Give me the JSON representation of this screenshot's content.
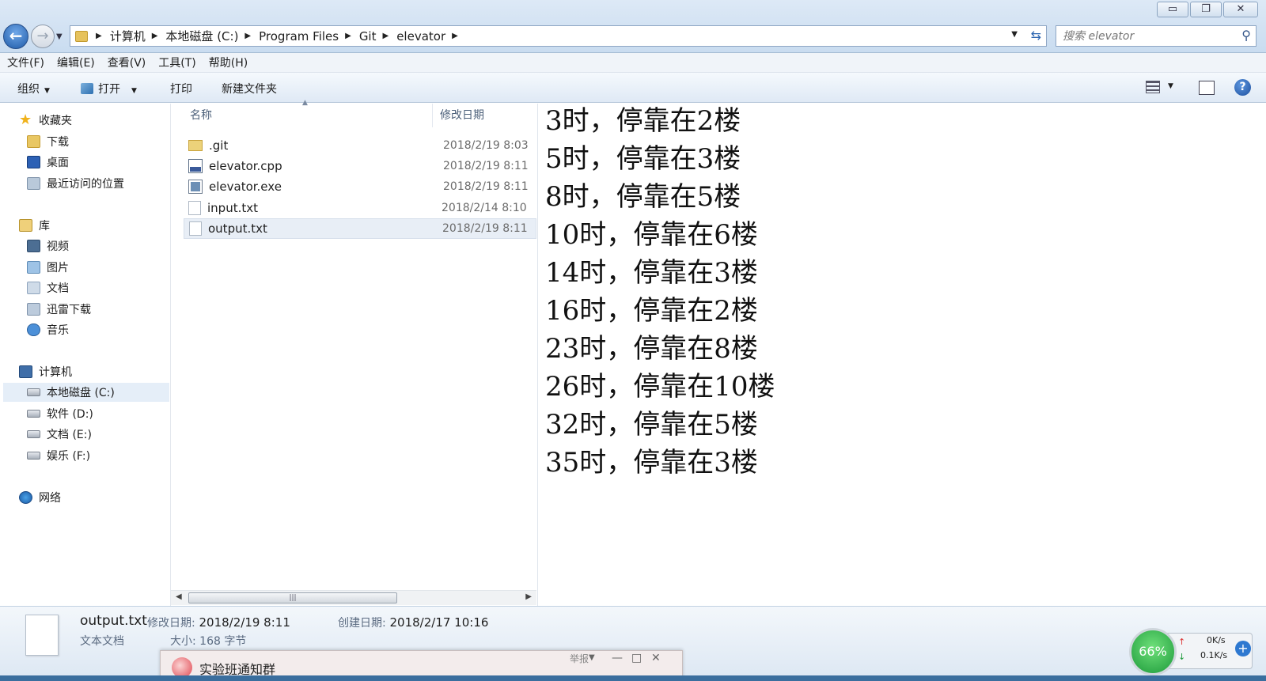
{
  "window": {
    "minimize": "▭",
    "restore": "❐",
    "close": "✕"
  },
  "address_bar": {
    "crumbs": [
      "计算机",
      "本地磁盘 (C:)",
      "Program Files",
      "Git",
      "elevator"
    ]
  },
  "search": {
    "placeholder": "搜索 elevator"
  },
  "menu": [
    "文件(F)",
    "编辑(E)",
    "查看(V)",
    "工具(T)",
    "帮助(H)"
  ],
  "toolbar": {
    "organize": "组织",
    "open": "打开",
    "print": "打印",
    "new_folder": "新建文件夹"
  },
  "nav": {
    "favorites": "收藏夹",
    "downloads": "下载",
    "desktop": "桌面",
    "recent": "最近访问的位置",
    "libraries": "库",
    "videos": "视频",
    "pictures": "图片",
    "documents": "文档",
    "xunlei": "迅雷下载",
    "music": "音乐",
    "computer": "计算机",
    "drive_c": "本地磁盘 (C:)",
    "drive_d": "软件 (D:)",
    "drive_e": "文档 (E:)",
    "drive_f": "娱乐 (F:)",
    "network": "网络"
  },
  "filelist": {
    "col_name": "名称",
    "col_date": "修改日期",
    "files": [
      {
        "name": ".git",
        "date": "2018/2/19 8:03",
        "icon": "folder-icon"
      },
      {
        "name": "elevator.cpp",
        "date": "2018/2/19 8:11",
        "icon": "cpp-file-icon"
      },
      {
        "name": "elevator.exe",
        "date": "2018/2/19 8:11",
        "icon": "exe-file-icon"
      },
      {
        "name": "input.txt",
        "date": "2018/2/14 8:10",
        "icon": "txt-file-icon"
      },
      {
        "name": "output.txt",
        "date": "2018/2/19 8:11",
        "icon": "txt-file-icon"
      }
    ]
  },
  "preview": {
    "lines": [
      "3时，停靠在2楼",
      "5时，停靠在3楼",
      "8时，停靠在5楼",
      "10时，停靠在6楼",
      "14时，停靠在3楼",
      "16时，停靠在2楼",
      "23时，停靠在8楼",
      "26时，停靠在10楼",
      "32时，停靠在5楼",
      "35时，停靠在3楼"
    ]
  },
  "details": {
    "name": "output.txt",
    "type": "文本文档",
    "modified_label": "修改日期:",
    "modified": "2018/2/19 8:11",
    "created_label": "创建日期:",
    "created": "2018/2/17 10:16",
    "size": "大小: 168 字节"
  },
  "popup": {
    "title": "实验班通知群",
    "report": "举报"
  },
  "net_widget": {
    "percent": "66%",
    "upload": "0K/s",
    "download": "0.1K/s"
  }
}
